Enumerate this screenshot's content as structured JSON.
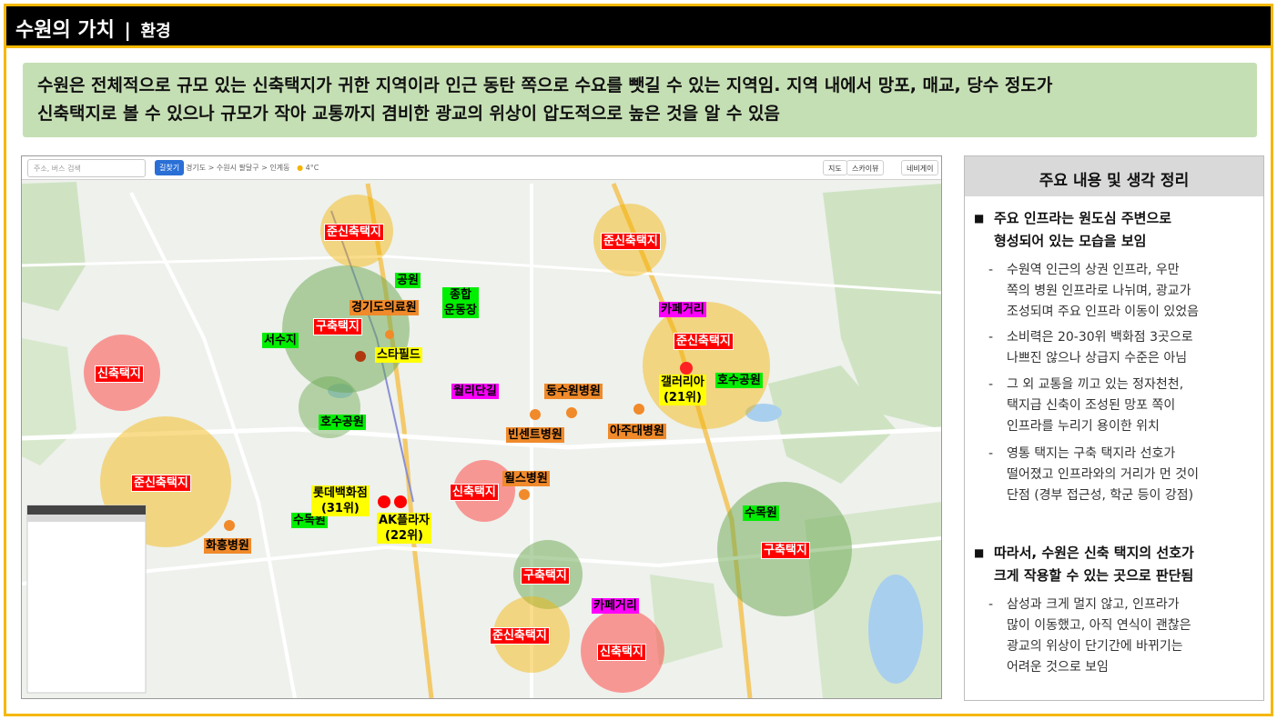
{
  "header": {
    "title": "수원의 가치",
    "separator": "|",
    "subtitle": "환경"
  },
  "summary": {
    "line1": "수원은 전체적으로 규모 있는 신축택지가 귀한 지역이라 인근 동탄 쪽으로 수요를 뺏길 수 있는 지역임. 지역 내에서 망포, 매교, 당수 정도가",
    "line2": "신축택지로 볼 수 있으나 규모가 작아 교통까지 겸비한 광교의 위상이 압도적으로 높은 것을 알 수 있음"
  },
  "map": {
    "toolbar": {
      "search_placeholder": "주소, 버스 검색",
      "route": "길찾기",
      "crumb": "경기도 > 수원시 팔달구 > 인계동",
      "weather": "4°C",
      "map_btn": "지도",
      "sky_btn": "스카이뷰",
      "more_btn": "네비게이"
    },
    "zone_labels": [
      {
        "text": "준신축택지",
        "kind": "red"
      },
      {
        "text": "준신축택지",
        "kind": "red"
      },
      {
        "text": "구축택지",
        "kind": "red"
      },
      {
        "text": "신축택지",
        "kind": "red"
      },
      {
        "text": "준신축택지",
        "kind": "red"
      },
      {
        "text": "준신축택지",
        "kind": "red"
      },
      {
        "text": "신축택지",
        "kind": "red"
      },
      {
        "text": "구축택지",
        "kind": "red"
      },
      {
        "text": "구축택지",
        "kind": "red"
      },
      {
        "text": "준신축택지",
        "kind": "red"
      },
      {
        "text": "신축택지",
        "kind": "red"
      }
    ],
    "park_labels": [
      "공원",
      "종합\n운동장",
      "서수지",
      "호수공원",
      "수목원",
      "호수공원",
      "수목원"
    ],
    "hospital_labels": [
      "경기도의료원",
      "동수원병원",
      "빈센트병원",
      "아주대병원",
      "윌스병원",
      "화홍병원"
    ],
    "cafe_labels": [
      "카페거리",
      "월리단길",
      "카페거리"
    ],
    "mall_labels": [
      "스타필드",
      "갤러리아\n(21위)",
      "롯데백화점\n(31위)",
      "AK플라자\n(22위)"
    ],
    "colors": {
      "new_zone": "#ff4d4d",
      "semi_new_zone": "#f5b400",
      "old_zone": "#6aa84f",
      "frame_accent": "#f5b800",
      "summary_bg": "#c5dfb4"
    }
  },
  "panel": {
    "title": "주요 내용 및 생각 정리",
    "point1": {
      "bullet": "■",
      "lines": [
        "주요 인프라는 원도심 주변으로",
        "형성되어 있는 모습을 보임"
      ]
    },
    "subs1": [
      {
        "lines": [
          "수원역 인근의 상권 인프라, 우만",
          "쪽의 병원 인프라로 나뉘며, 광교가",
          "조성되며 주요 인프라 이동이 있었음"
        ]
      },
      {
        "lines": [
          "소비력은 20-30위 백화점 3곳으로",
          "나쁘진 않으나 상급지 수준은 아님"
        ]
      },
      {
        "lines": [
          "그 외 교통을 끼고 있는 정자천천,",
          "택지급 신축이 조성된 망포 쪽이",
          "인프라를 누리기 용이한 위치"
        ]
      },
      {
        "lines": [
          "영통 택지는 구축 택지라 선호가",
          "떨어졌고 인프라와의 거리가 먼 것이",
          "단점 (경부 접근성, 학군 등이 강점)"
        ]
      }
    ],
    "point2": {
      "bullet": "■",
      "lines": [
        "따라서, 수원은 신축 택지의 선호가",
        "크게 작용할 수 있는 곳으로 판단됨"
      ]
    },
    "subs2": [
      {
        "lines": [
          "삼성과 크게 멀지 않고, 인프라가",
          "많이 이동했고, 아직 연식이 괜찮은",
          "광교의 위상이 단기간에 바뀌기는",
          "어려운 것으로 보임"
        ]
      }
    ],
    "dash": "-"
  }
}
